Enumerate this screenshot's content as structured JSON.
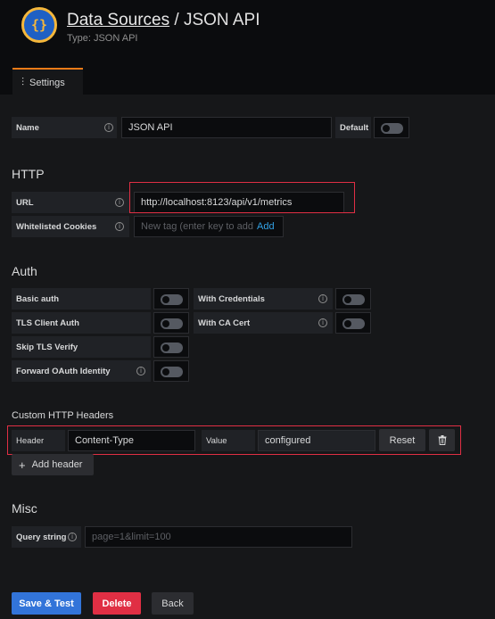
{
  "header": {
    "icon_text": "{}",
    "breadcrumb_link": "Data Sources",
    "separator": " / ",
    "title": "JSON API",
    "subtitle": "Type: JSON API"
  },
  "tabs": [
    {
      "label": "Settings",
      "icon": "sliders-icon",
      "active": true
    }
  ],
  "general": {
    "name_label": "Name",
    "name_value": "JSON API",
    "default_label": "Default",
    "default_enabled": false
  },
  "http": {
    "section_title": "HTTP",
    "url_label": "URL",
    "url_value": "http://localhost:8123/api/v1/metrics",
    "cookies_label": "Whitelisted Cookies",
    "cookies_placeholder": "New tag (enter key to add",
    "cookies_add": "Add"
  },
  "auth": {
    "section_title": "Auth",
    "basic_auth": "Basic auth",
    "with_credentials": "With Credentials",
    "tls_client_auth": "TLS Client Auth",
    "with_ca_cert": "With CA Cert",
    "skip_tls_verify": "Skip TLS Verify",
    "forward_oauth": "Forward OAuth Identity"
  },
  "custom_headers": {
    "section_title": "Custom HTTP Headers",
    "header_label": "Header",
    "header_value": "Content-Type",
    "value_label": "Value",
    "value_value": "configured",
    "reset_label": "Reset",
    "add_header_label": "Add header"
  },
  "misc": {
    "section_title": "Misc",
    "query_label": "Query string",
    "query_placeholder": "page=1&limit=100"
  },
  "footer": {
    "save_label": "Save & Test",
    "delete_label": "Delete",
    "back_label": "Back"
  },
  "colors": {
    "accent_orange": "#eb7b18",
    "primary_blue": "#3274d9",
    "danger_red": "#e02f44",
    "highlight_red": "#e02f44"
  }
}
